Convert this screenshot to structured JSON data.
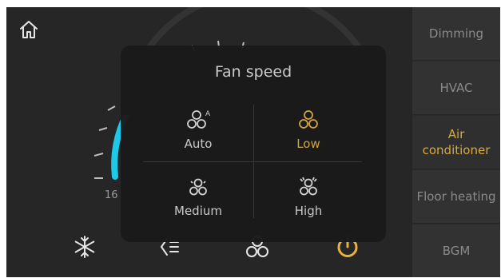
{
  "home_icon": "home-icon",
  "sidebar": {
    "items": [
      {
        "label": "Dimming",
        "active": false
      },
      {
        "label": "HVAC",
        "active": false
      },
      {
        "label": "Air conditioner",
        "active": true
      },
      {
        "label": "Floor heating",
        "active": false
      },
      {
        "label": "BGM",
        "active": false
      }
    ]
  },
  "gauge": {
    "min_label": "16"
  },
  "fan_speed_dialog": {
    "title": "Fan speed",
    "options": [
      {
        "label": "Auto",
        "icon": "fan-auto-icon",
        "selected": false
      },
      {
        "label": "Low",
        "icon": "fan-low-icon",
        "selected": true
      },
      {
        "label": "Medium",
        "icon": "fan-medium-icon",
        "selected": false
      },
      {
        "label": "High",
        "icon": "fan-high-icon",
        "selected": false
      }
    ]
  },
  "bottom_bar": {
    "icons": [
      "snowflake-icon",
      "swing-icon",
      "fan-icon",
      "power-icon"
    ]
  },
  "colors": {
    "accent": "#d8a93e",
    "gauge": "#1ec8e8"
  }
}
